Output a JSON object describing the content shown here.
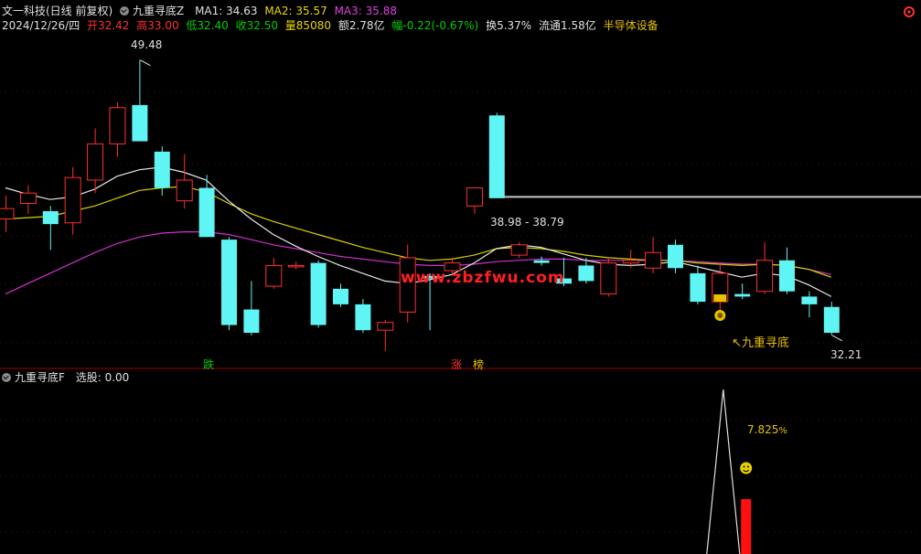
{
  "header": {
    "stock_name": "文一科技(日线 前复权)",
    "indicator_name": "九重寻底Z",
    "ma1": "MA1: 34.63",
    "ma2": "MA2: 35.57",
    "ma3": "MA3: 35.88"
  },
  "info": {
    "date": "2024/12/26/四",
    "open": "开32.42",
    "high": "高33.00",
    "low": "低32.40",
    "close": "收32.50",
    "volume": "量85080",
    "amount": "额2.78亿",
    "change": "幅-0.22(-0.67%)",
    "turnover": "换5.37%",
    "float": "流通1.58亿",
    "sector": "半导体设备"
  },
  "annotations": {
    "high_price": "49.48",
    "low_price": "32.21",
    "level_range": "38.98 - 38.79",
    "signal_text": "九重寻底",
    "drop_label": "跌",
    "rise_label": "涨",
    "rank_label": "榜",
    "watermark": "www.zbzfwu.com"
  },
  "sub_panel": {
    "title": "九重寻底F",
    "selection": "选股: 0.00",
    "percent": "7.825",
    "percent_suffix": "%"
  },
  "colors": {
    "up": "#ff3030",
    "down": "#5ff5f5",
    "ma1": "#e8e8e8",
    "ma2": "#d8d000",
    "ma3": "#d030d0"
  },
  "chart_data": {
    "type": "candlestick",
    "candles": [
      {
        "o": 37.2,
        "h": 39.0,
        "c": 38.0,
        "l": 36.2
      },
      {
        "o": 38.4,
        "h": 39.8,
        "c": 39.2,
        "l": 37.6
      },
      {
        "o": 37.8,
        "h": 38.2,
        "c": 36.8,
        "l": 34.8
      },
      {
        "o": 36.9,
        "h": 41.2,
        "c": 40.4,
        "l": 36.0
      },
      {
        "o": 40.2,
        "h": 44.2,
        "c": 43.0,
        "l": 39.2
      },
      {
        "o": 43.0,
        "h": 46.2,
        "c": 45.8,
        "l": 42.0
      },
      {
        "o": 46.0,
        "h": 49.48,
        "c": 43.2,
        "l": 43.2
      },
      {
        "o": 42.4,
        "h": 42.8,
        "c": 39.6,
        "l": 39.0
      },
      {
        "o": 38.6,
        "h": 42.2,
        "c": 40.2,
        "l": 38.0
      },
      {
        "o": 39.6,
        "h": 40.6,
        "c": 35.8,
        "l": 35.8
      },
      {
        "o": 35.6,
        "h": 35.8,
        "c": 29.0,
        "l": 28.6
      },
      {
        "o": 30.2,
        "h": 32.4,
        "c": 28.4,
        "l": 28.2
      },
      {
        "o": 32.0,
        "h": 34.2,
        "c": 33.6,
        "l": 31.8
      },
      {
        "o": 33.6,
        "h": 33.9,
        "c": 33.6,
        "l": 33.3
      },
      {
        "o": 33.8,
        "h": 34.0,
        "c": 29.0,
        "l": 28.8
      },
      {
        "o": 31.8,
        "h": 32.2,
        "c": 30.6,
        "l": 30.4
      },
      {
        "o": 30.6,
        "h": 31.0,
        "c": 28.6,
        "l": 28.4
      },
      {
        "o": 28.6,
        "h": 29.4,
        "c": 29.2,
        "l": 27.0
      },
      {
        "o": 30.0,
        "h": 35.2,
        "c": 34.2,
        "l": 29.2
      },
      {
        "o": 32.8,
        "h": 33.0,
        "c": 32.6,
        "l": 28.6
      },
      {
        "o": 33.2,
        "h": 34.2,
        "c": 33.8,
        "l": 32.8
      },
      {
        "o": 38.2,
        "h": 39.4,
        "c": 39.6,
        "l": 37.6
      },
      {
        "o": 45.2,
        "h": 45.4,
        "c": 38.8,
        "l": 38.8
      },
      {
        "o": 34.4,
        "h": 35.4,
        "c": 35.2,
        "l": 34.2
      },
      {
        "o": 34.0,
        "h": 34.3,
        "c": 33.8,
        "l": 33.6
      },
      {
        "o": 32.6,
        "h": 34.2,
        "c": 32.2,
        "l": 32.0
      },
      {
        "o": 33.6,
        "h": 34.2,
        "c": 32.4,
        "l": 32.2
      },
      {
        "o": 31.4,
        "h": 34.2,
        "c": 33.8,
        "l": 31.2
      },
      {
        "o": 33.8,
        "h": 34.8,
        "c": 34.0,
        "l": 33.4
      },
      {
        "o": 33.4,
        "h": 35.8,
        "c": 34.6,
        "l": 33.0
      },
      {
        "o": 35.2,
        "h": 35.6,
        "c": 33.4,
        "l": 33.0
      },
      {
        "o": 33.0,
        "h": 33.6,
        "c": 30.8,
        "l": 30.6
      },
      {
        "o": 30.8,
        "h": 33.8,
        "c": 33.0,
        "l": 30.0
      },
      {
        "o": 31.4,
        "h": 32.2,
        "c": 31.2,
        "l": 31.0
      },
      {
        "o": 31.6,
        "h": 35.4,
        "c": 34.0,
        "l": 31.4
      },
      {
        "o": 34.0,
        "h": 35.0,
        "c": 31.6,
        "l": 31.4
      },
      {
        "o": 31.2,
        "h": 31.6,
        "c": 30.6,
        "l": 29.6
      },
      {
        "o": 30.4,
        "h": 30.8,
        "c": 28.4,
        "l": 28.2
      }
    ],
    "ma1": [
      39.6,
      39.1,
      38.7,
      38.9,
      39.5,
      40.5,
      41.0,
      41.2,
      40.8,
      40.2,
      38.6,
      37.2,
      36.0,
      35.1,
      34.3,
      33.6,
      33.0,
      32.4,
      32.2,
      32.5,
      32.9,
      33.8,
      34.9,
      35.2,
      35.0,
      34.5,
      34.0,
      33.7,
      33.6,
      33.7,
      33.9,
      33.5,
      33.1,
      32.7,
      33.0,
      32.8,
      32.1,
      31.2
    ],
    "ma2": [
      37.2,
      37.3,
      37.4,
      37.8,
      38.2,
      38.8,
      39.4,
      39.6,
      39.7,
      39.3,
      38.4,
      37.6,
      37.0,
      36.5,
      36.0,
      35.5,
      35.0,
      34.6,
      34.2,
      34.0,
      34.1,
      34.4,
      34.9,
      35.0,
      34.9,
      34.7,
      34.4,
      34.2,
      34.1,
      34.0,
      34.0,
      33.8,
      33.7,
      33.6,
      33.7,
      33.6,
      33.3,
      32.7
    ],
    "ma3": [
      31.4,
      32.2,
      33.0,
      33.8,
      34.6,
      35.3,
      35.8,
      36.1,
      36.2,
      36.2,
      36.0,
      35.6,
      35.2,
      34.9,
      34.6,
      34.3,
      34.1,
      33.9,
      33.7,
      33.6,
      33.6,
      33.7,
      33.9,
      34.0,
      34.1,
      34.1,
      34.0,
      34.0,
      34.0,
      34.0,
      34.0,
      33.9,
      33.8,
      33.7,
      33.7,
      33.6,
      33.3,
      32.9
    ],
    "level": 38.9,
    "ylim": [
      26.0,
      52.0
    ],
    "sub": {
      "spike_at": 32,
      "bar_at": 33
    }
  }
}
